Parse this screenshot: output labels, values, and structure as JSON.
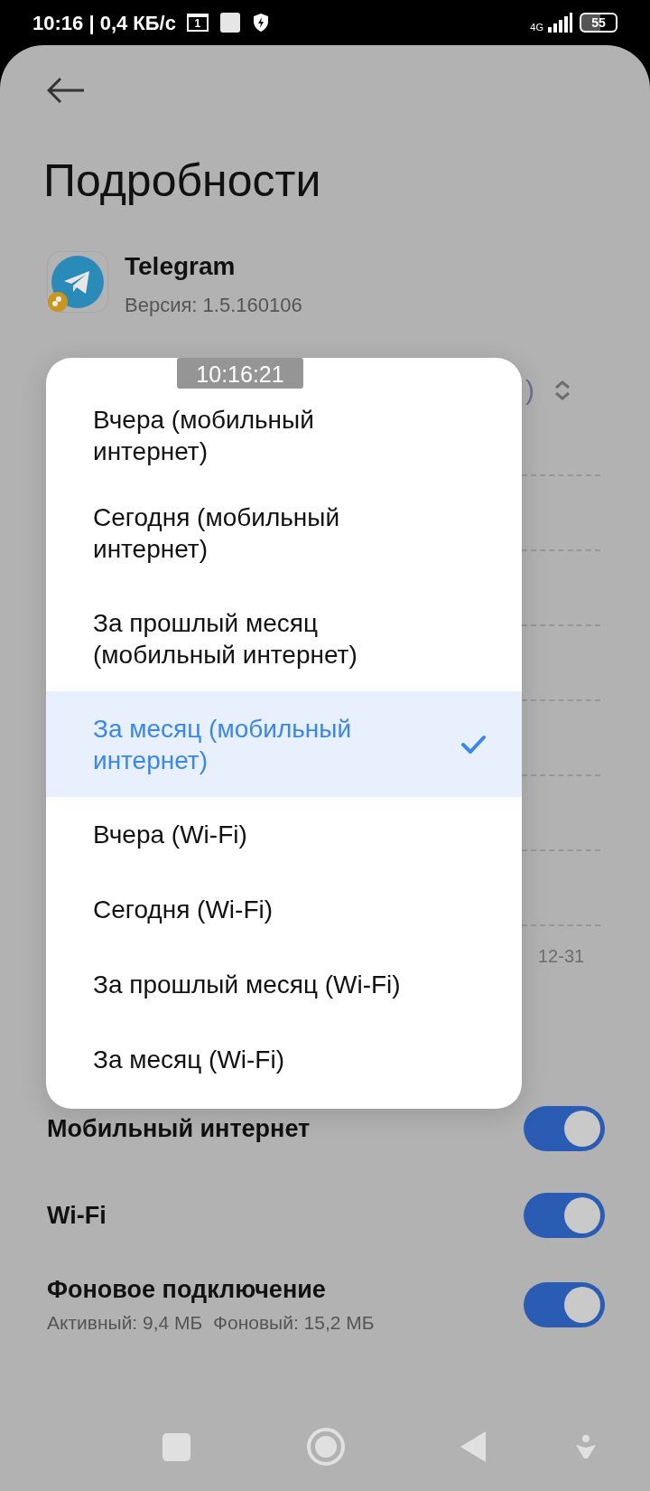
{
  "status_bar": {
    "clock_speed": "10:16 | 0,4 КБ/с",
    "sim_number": "1",
    "network_type": "4G",
    "battery": "55"
  },
  "page": {
    "title": "Подробности"
  },
  "app": {
    "name": "Telegram",
    "version": "Версия: 1.5.160106"
  },
  "usage_panel": {
    "selector_fragment": ")",
    "date_label": "12-31"
  },
  "toggles": [
    {
      "label": "Мобильный интернет",
      "on": true
    },
    {
      "label": "Wi-Fi",
      "on": true
    },
    {
      "label": "Фоновое подключение",
      "detail": "Активный: 9,4 МБ  Фоновый: 15,2 МБ",
      "on": true
    }
  ],
  "dropdown": {
    "options": [
      {
        "label": "Вчера (мобильный интернет)",
        "selected": false
      },
      {
        "label": "Сегодня (мобильный интернет)",
        "selected": false
      },
      {
        "label": "За прошлый месяц (мобильный интернет)",
        "selected": false
      },
      {
        "label": "За месяц (мобильный интернет)",
        "selected": true
      },
      {
        "label": "Вчера (Wi-Fi)",
        "selected": false
      },
      {
        "label": "Сегодня (Wi-Fi)",
        "selected": false
      },
      {
        "label": "За прошлый месяц (Wi-Fi)",
        "selected": false
      },
      {
        "label": "За месяц (Wi-Fi)",
        "selected": false
      }
    ]
  },
  "recording_timestamp": "10:16:21"
}
